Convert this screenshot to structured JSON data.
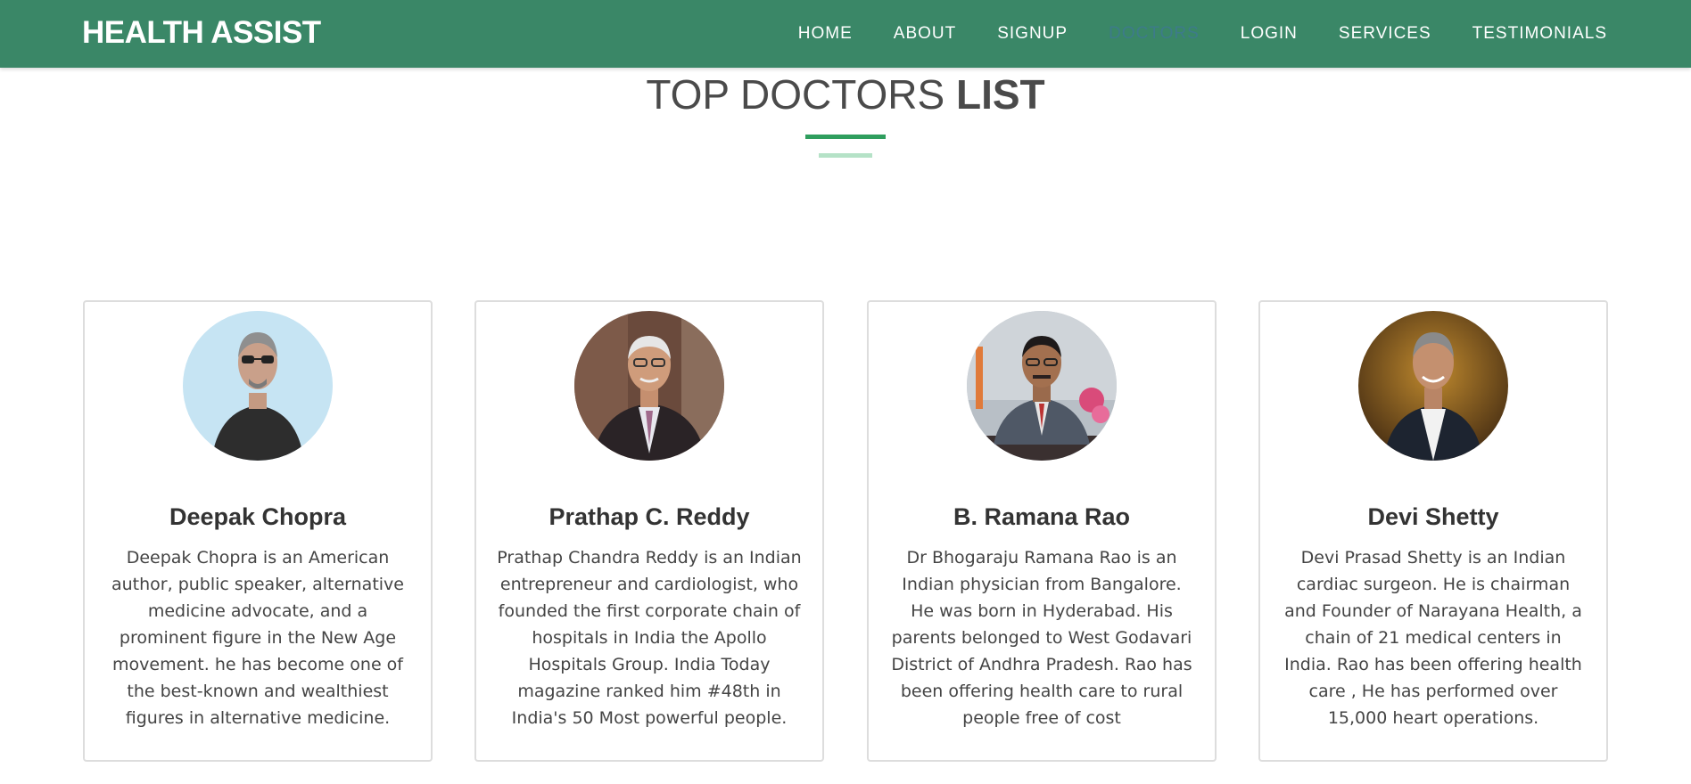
{
  "nav": {
    "brand": "HEALTH ASSIST",
    "links": [
      {
        "label": "HOME"
      },
      {
        "label": "ABOUT"
      },
      {
        "label": "SIGNUP"
      },
      {
        "label": "DOCTORS",
        "active": true
      },
      {
        "label": "LOGIN"
      },
      {
        "label": "SERVICES"
      },
      {
        "label": "TESTIMONIALS"
      }
    ]
  },
  "section": {
    "title_light": "TOP DOCTORS ",
    "title_bold": "LIST"
  },
  "doctors": [
    {
      "name": "Deepak Chopra",
      "description": "Deepak Chopra is an American author, public speaker, alternative medicine advocate, and a prominent figure in the New Age movement. he has become one of the best-known and wealthiest figures in alternative medicine."
    },
    {
      "name": "Prathap C. Reddy",
      "description": "Prathap Chandra Reddy is an Indian entrepreneur and cardiologist, who founded the first corporate chain of hospitals in India the Apollo Hospitals Group. India Today magazine ranked him #48th in India's 50 Most powerful people."
    },
    {
      "name": "B. Ramana Rao",
      "description": "Dr Bhogaraju Ramana Rao is an Indian physician from Bangalore. He was born in Hyderabad. His parents belonged to West Godavari District of Andhra Pradesh. Rao has been offering health care to rural people free of cost"
    },
    {
      "name": "Devi Shetty",
      "description": "Devi Prasad Shetty is an Indian cardiac surgeon. He is chairman and Founder of Narayana Health, a chain of 21 medical centers in India. Rao has been offering health care , He has performed over 15,000 heart operations."
    }
  ],
  "colors": {
    "navbar": "#3a8767",
    "active_link": "#3d7b8a",
    "accent_line": "#2f9e5e",
    "accent_line_light": "#b5e2c7"
  }
}
